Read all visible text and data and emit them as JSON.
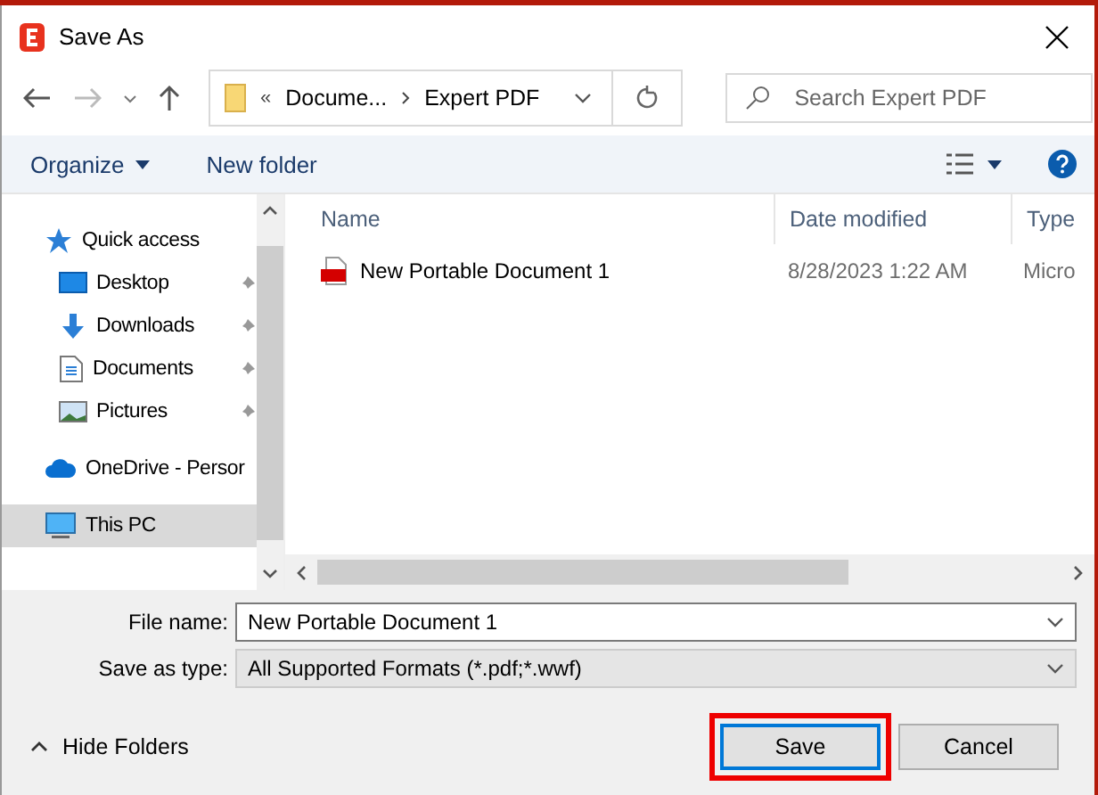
{
  "window": {
    "title": "Save As"
  },
  "address": {
    "segments": [
      "«",
      "Docume...",
      "Expert PDF"
    ]
  },
  "search": {
    "placeholder": "Search Expert PDF"
  },
  "toolbar": {
    "organize": "Organize",
    "new_folder": "New folder"
  },
  "sidebar": {
    "items": [
      {
        "label": "Quick access",
        "kind": "star",
        "pinned": false,
        "selected": false,
        "indent": false
      },
      {
        "label": "Desktop",
        "kind": "desktop",
        "pinned": true,
        "selected": false,
        "indent": true
      },
      {
        "label": "Downloads",
        "kind": "download",
        "pinned": true,
        "selected": false,
        "indent": true
      },
      {
        "label": "Documents",
        "kind": "document",
        "pinned": true,
        "selected": false,
        "indent": true
      },
      {
        "label": "Pictures",
        "kind": "picture",
        "pinned": true,
        "selected": false,
        "indent": true
      },
      {
        "label": "OneDrive - Persor",
        "kind": "cloud",
        "pinned": false,
        "selected": false,
        "indent": false
      },
      {
        "label": "This PC",
        "kind": "pc",
        "pinned": false,
        "selected": true,
        "indent": false
      }
    ]
  },
  "table": {
    "columns": [
      "Name",
      "Date modified",
      "Type"
    ],
    "rows": [
      {
        "name": "New Portable Document 1",
        "date": "8/28/2023 1:22 AM",
        "type": "Micro"
      }
    ]
  },
  "form": {
    "file_name_label": "File name:",
    "file_name": "New Portable Document 1",
    "type_label": "Save as type:",
    "type": "All Supported Formats (*.pdf;*.wwf)"
  },
  "hide_folders": "Hide Folders",
  "buttons": [
    {
      "label": "Save",
      "highlighted": true
    },
    {
      "label": "Cancel",
      "highlighted": false
    }
  ]
}
